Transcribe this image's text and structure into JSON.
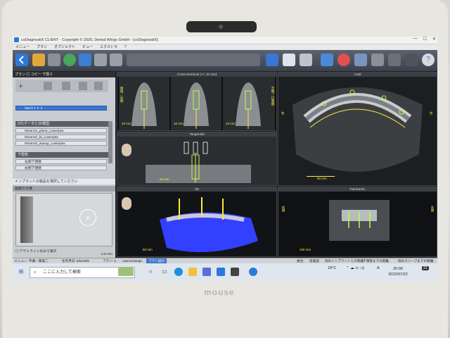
{
  "window": {
    "title": "coDiagnostiX CLIENT - Copyright © 2020, Dental Wings GmbH - [coDiagnostiX]",
    "controls": [
      "—",
      "☐",
      "✕"
    ]
  },
  "menu": [
    "メニュー",
    "プラン",
    "オブジェクト",
    "ビュー",
    "エクストラ",
    "?"
  ],
  "left_panel": {
    "header": "プラン  ◎  コピー 下顎 2",
    "selected_item": "GEパイト 2",
    "stl_section": "STLデータと3D模型",
    "stl_items": [
      "Niramori_plane_Lowerjaw",
      "Niramori_bt_Lowerjaw",
      "Niramori_waxup_Lowerjaw"
    ],
    "nerve_section": "下顎管",
    "nerve_items": [
      "左側下顎管",
      "右側下顎管"
    ],
    "implant_hint": "インプラントの製品を選択してください",
    "preview_header": "画面の仕様",
    "checkbox_label": "アウトラインのみで表示",
    "zoom_value": "2.5 mm"
  },
  "views": {
    "cross_sectional": {
      "title": "Cross-sectional (+/- 10 mm)",
      "scale": [
        "10 mm",
        "10 mm",
        "10 mm"
      ],
      "side_left": "頬側／舌側",
      "side_right": "舌側／口蓋側"
    },
    "axial": {
      "title": "Axial",
      "scale": "50 mm",
      "side_left": "右",
      "side_right": "左"
    },
    "tangential": {
      "title": "Tangential",
      "scale": "50 mm"
    },
    "three_d": {
      "title": "3D",
      "scale": "50 mm"
    },
    "panoramic": {
      "title": "Panoramic",
      "scale": "100 mm",
      "side_left": "右側",
      "side_right": "左側"
    }
  },
  "status_bar": {
    "user": "メニュー: 平瀬・陽道二",
    "birth": "生年月日: 5/5/1909",
    "plan": "プラン: 2",
    "case": "caseXchange:",
    "case_tab": "プラン送付",
    "right": [
      "歯合:",
      "密着度:",
      "他のインプラントとの距離:",
      "下顎管までの距離:",
      "他のスリーブまでの距離:"
    ]
  },
  "taskbar": {
    "search_placeholder": "ここに入力して検索",
    "weather": "18°C",
    "ime": "A",
    "time": "20:00",
    "date": "2022/07/22",
    "notifications": "21"
  },
  "bezel_brand": "mouse",
  "colors": {
    "accent": "#3a76d2",
    "yellow": "#ffea3a",
    "implant_green": "#b8ff4a",
    "bone_blue": "#3340ff"
  }
}
